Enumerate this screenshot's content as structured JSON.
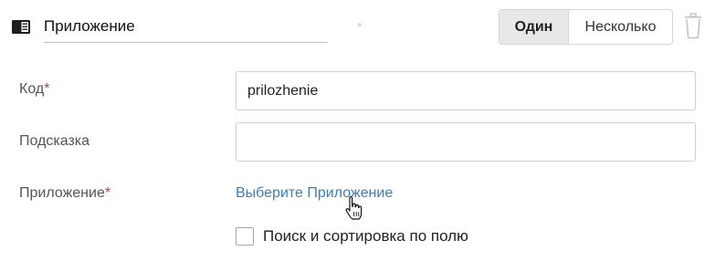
{
  "header": {
    "field_name": "Приложение",
    "required_marker": "*",
    "mode": {
      "options": [
        "Один",
        "Несколько"
      ],
      "selected": "Один"
    }
  },
  "fields": {
    "code": {
      "label": "Код",
      "required": "*",
      "value": "prilozhenie"
    },
    "hint": {
      "label": "Подсказка",
      "value": ""
    },
    "app": {
      "label": "Приложение",
      "required": "*",
      "link_text": "Выберите Приложение"
    }
  },
  "search_sort": {
    "label": "Поиск и сортировка по полю",
    "checked": false
  },
  "colors": {
    "accent_link": "#3d7fb5",
    "required": "#d0342c",
    "selected_segment": "#e8e8e8"
  },
  "icons": [
    "field-type-icon",
    "trash-icon",
    "hand-cursor-icon"
  ]
}
